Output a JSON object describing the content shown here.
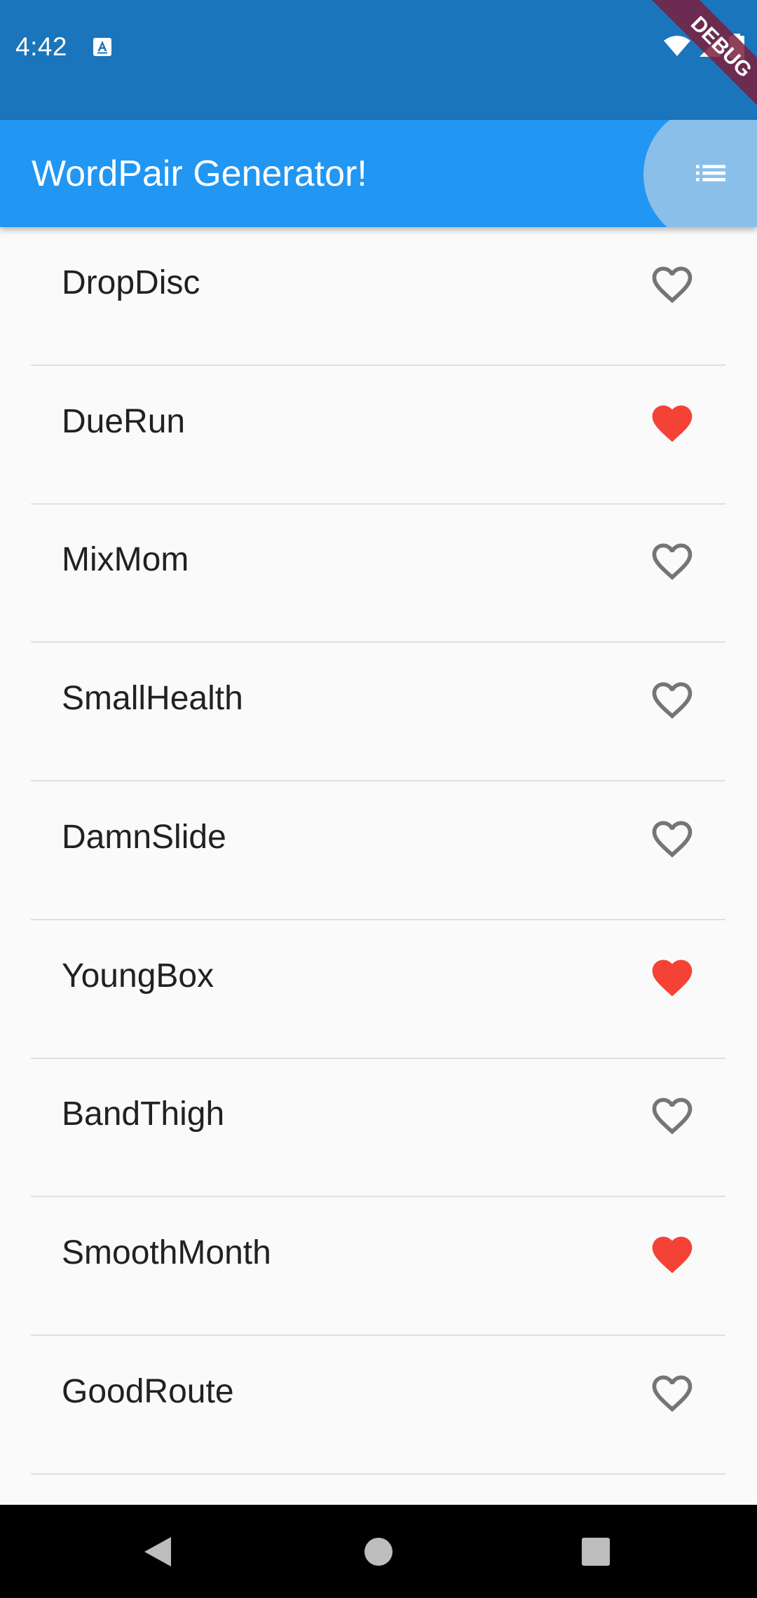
{
  "status_bar": {
    "time": "4:42",
    "notification_icon": "accessibility-a-icon",
    "icons": [
      "wifi-icon",
      "signal-icon",
      "battery-icon"
    ],
    "color": "#1a75bc"
  },
  "debug_banner": {
    "label": "DEBUG",
    "color": "#7b1f3d"
  },
  "app_bar": {
    "title": "WordPair Generator!",
    "action_icon": "list-icon",
    "color": "#2196f3"
  },
  "list": {
    "items": [
      {
        "label": "DropDisc",
        "saved": false
      },
      {
        "label": "DueRun",
        "saved": true
      },
      {
        "label": "MixMom",
        "saved": false
      },
      {
        "label": "SmallHealth",
        "saved": false
      },
      {
        "label": "DamnSlide",
        "saved": false
      },
      {
        "label": "YoungBox",
        "saved": true
      },
      {
        "label": "BandThigh",
        "saved": false
      },
      {
        "label": "SmoothMonth",
        "saved": true
      },
      {
        "label": "GoodRoute",
        "saved": false
      }
    ],
    "saved_color": "#f44336",
    "unsaved_color": "#757575"
  },
  "nav_bar": {
    "buttons": [
      "back-icon",
      "home-icon",
      "recents-icon"
    ]
  }
}
